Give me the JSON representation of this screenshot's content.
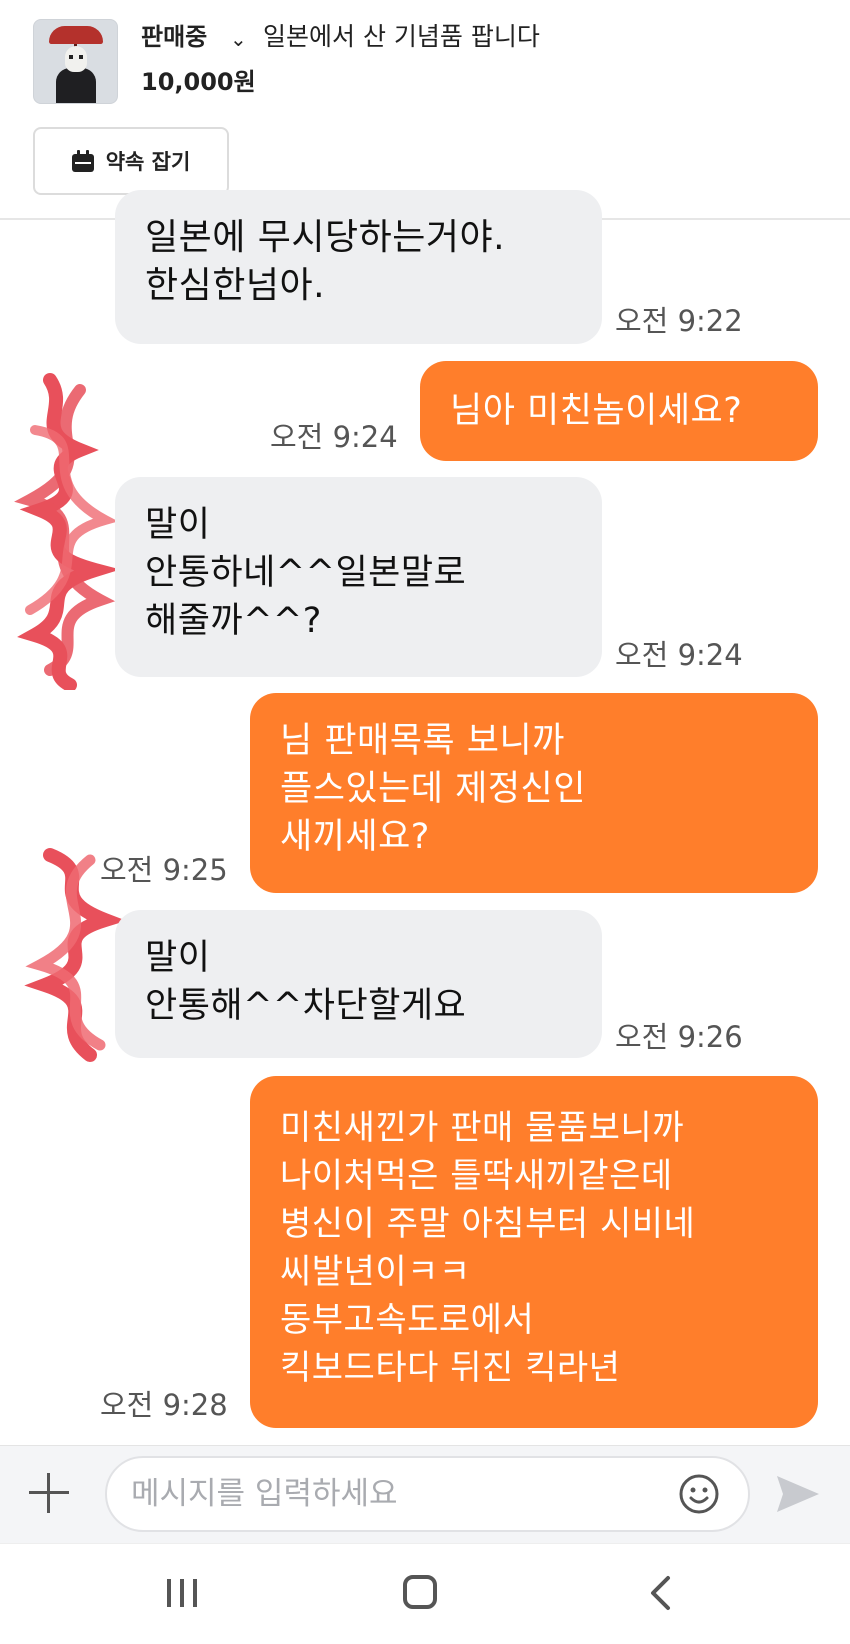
{
  "header": {
    "status": "판매중",
    "status_chevron": "chevron-down-icon",
    "item_title": "일본에서 산 기념품 팝니다",
    "price": "10,000원",
    "appointment_button": "약속 잡기",
    "appointment_icon": "calendar-icon"
  },
  "messages": [
    {
      "side": "in",
      "text": "일본에 무시당하는거야.\n한심한넘아.",
      "time": "오전 9:22"
    },
    {
      "side": "out",
      "text": "님아 미친놈이세요?",
      "time": "오전 9:24"
    },
    {
      "side": "in",
      "text": "말이\n안통하네^^일본말로\n해줄까^^?",
      "time": "오전 9:24"
    },
    {
      "side": "out",
      "text": "님 판매목록 보니까\n플스있는데 제정신인\n새끼세요?",
      "time": "오전 9:25"
    },
    {
      "side": "in",
      "text": "말이\n안통해^^차단할게요",
      "time": "오전 9:26"
    },
    {
      "side": "out",
      "text": "미친새낀가 판매 물품보니까\n나이처먹은 틀딱새끼같은데\n병신이 주말 아침부터 시비네\n씨발년이ㅋㅋ\n동부고속도로에서\n킥보드타다 뒤진 킥라년",
      "time": "오전 9:28"
    }
  ],
  "input": {
    "placeholder": "메시지를 입력하세요",
    "plus_icon": "plus-icon",
    "emoji_icon": "smile-icon",
    "send_icon": "send-icon"
  },
  "navbar": {
    "recent_icon": "recent-apps-icon",
    "home_icon": "home-icon",
    "back_icon": "back-icon"
  },
  "colors": {
    "outgoing_bubble": "#ff7e2b",
    "incoming_bubble": "#eeeff1",
    "redaction": "#e8505b"
  }
}
